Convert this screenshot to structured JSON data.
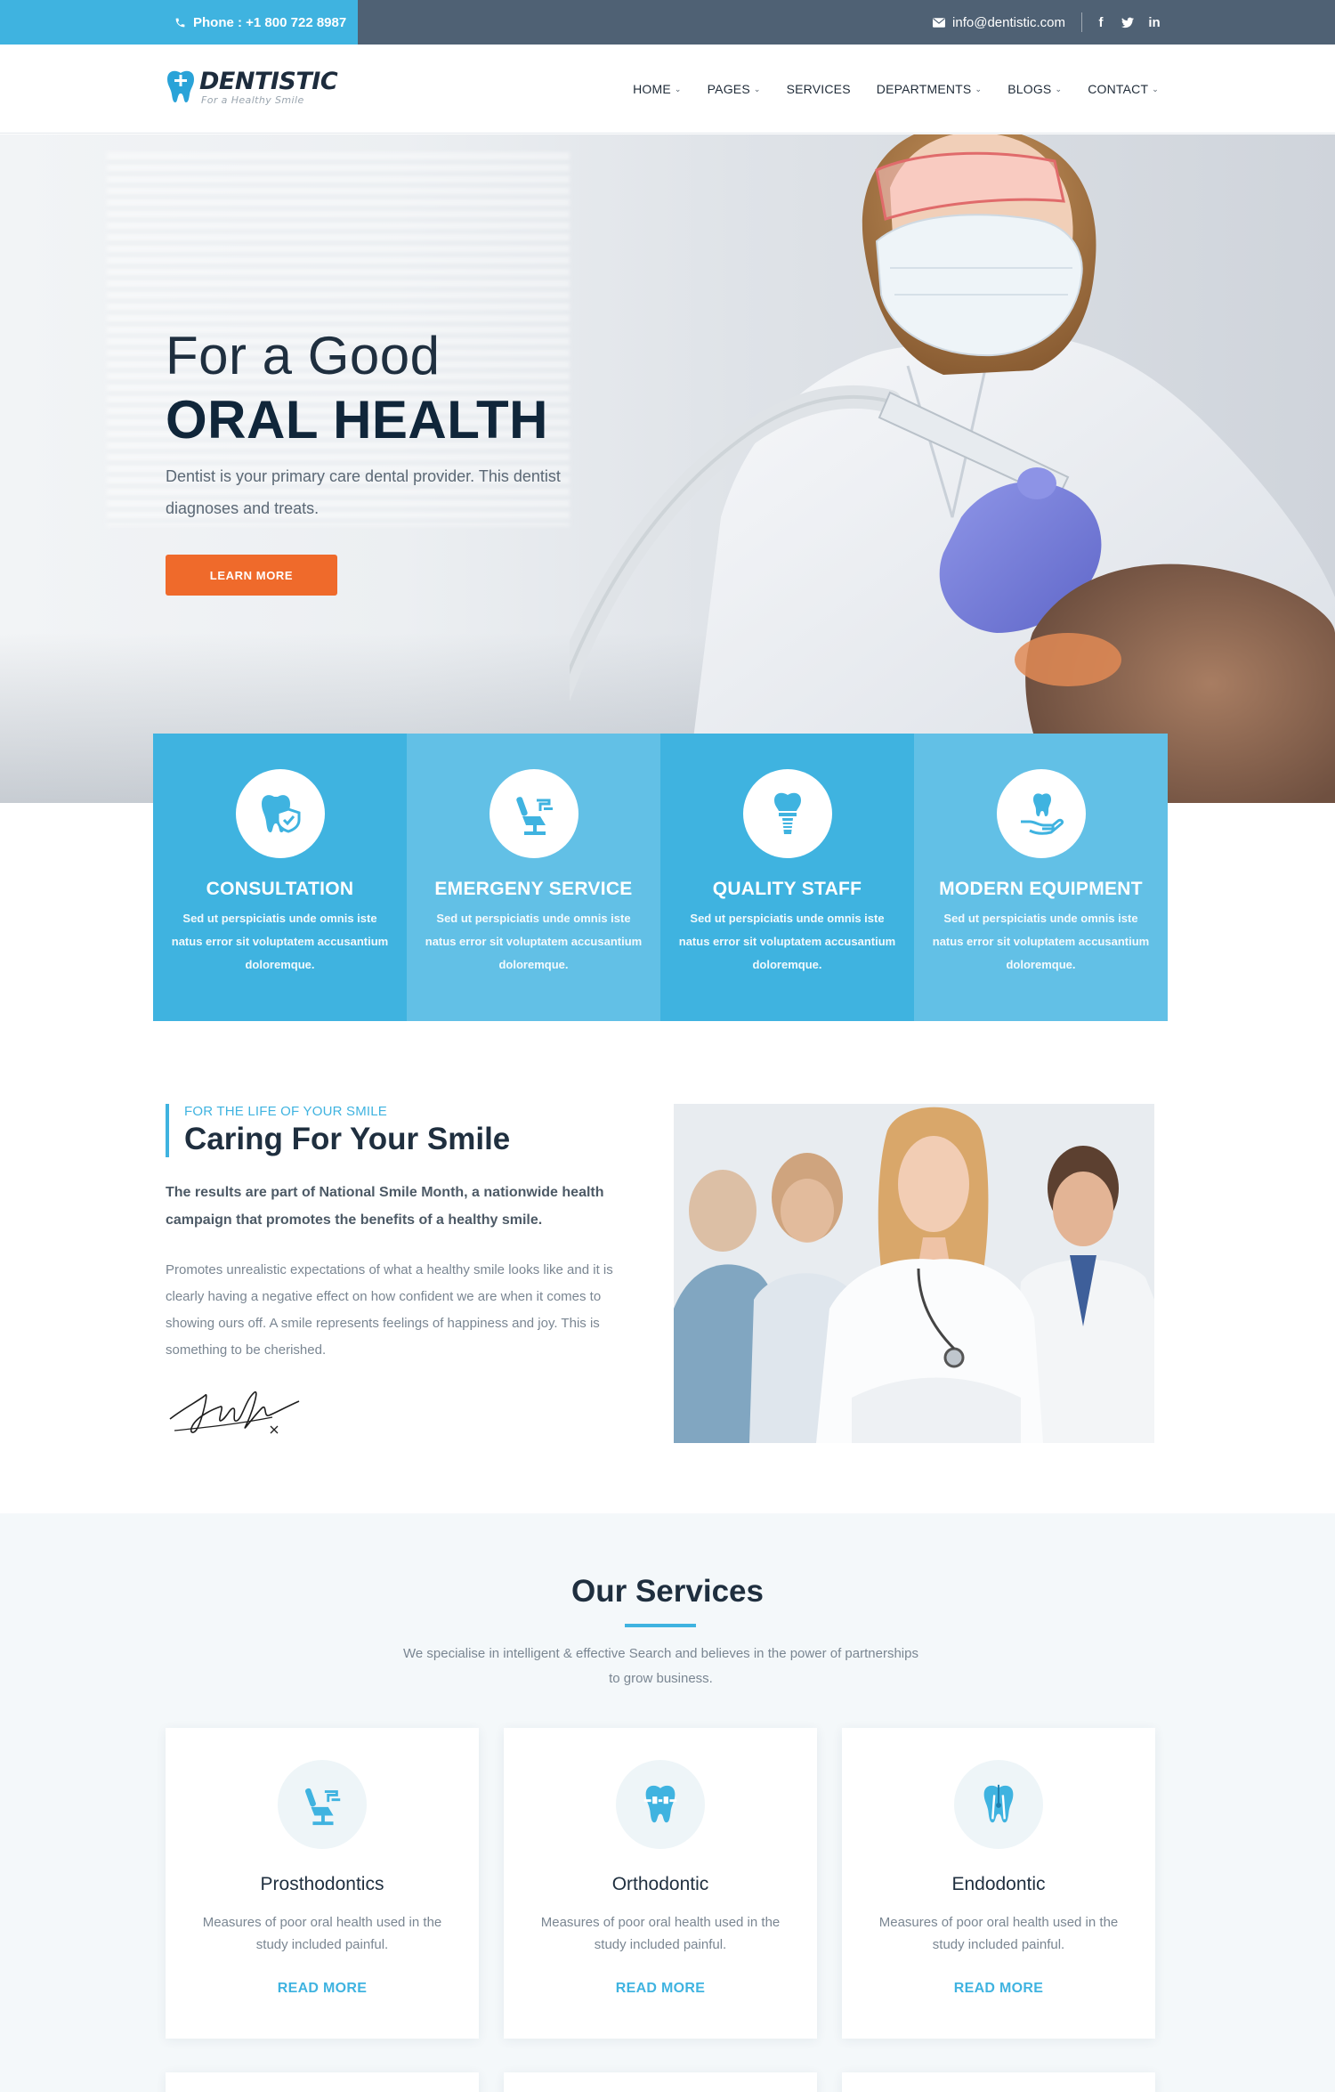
{
  "topbar": {
    "phone": "Phone : +1 800 722 8987",
    "email": "info@dentistic.com",
    "social": [
      {
        "icon": "facebook-icon",
        "glyph": "f"
      },
      {
        "icon": "twitter-icon",
        "glyph": "t"
      },
      {
        "icon": "linkedin-icon",
        "glyph": "in"
      }
    ]
  },
  "brand": {
    "name": "DENTISTIC",
    "tagline": "For a Healthy Smile"
  },
  "nav": {
    "items": [
      {
        "label": "HOME",
        "dropdown": true
      },
      {
        "label": "PAGES",
        "dropdown": true
      },
      {
        "label": "SERVICES",
        "dropdown": false
      },
      {
        "label": "DEPARTMENTS",
        "dropdown": true
      },
      {
        "label": "BLOGS",
        "dropdown": true
      },
      {
        "label": "CONTACT",
        "dropdown": true
      }
    ]
  },
  "hero": {
    "title_line1": "For a Good",
    "title_line2": "ORAL HEALTH",
    "text": "Dentist is your primary care dental provider. This dentist diagnoses and treats.",
    "button": "LEARN MORE"
  },
  "features": [
    {
      "title": "CONSULTATION",
      "desc": "Sed ut perspiciatis unde omnis iste natus error sit voluptatem accusantium doloremque.",
      "icon": "tooth-shield-icon",
      "bg": "#3fb3e0"
    },
    {
      "title": "EMERGENY SERVICE",
      "desc": "Sed ut perspiciatis unde omnis iste natus error sit voluptatem accusantium doloremque.",
      "icon": "dental-chair-icon",
      "bg": "#62c0e6"
    },
    {
      "title": "QUALITY STAFF",
      "desc": "Sed ut perspiciatis unde omnis iste natus error sit voluptatem accusantium doloremque.",
      "icon": "dental-implant-icon",
      "bg": "#3fb3e0"
    },
    {
      "title": "MODERN EQUIPMENT",
      "desc": "Sed ut perspiciatis unde omnis iste natus error sit voluptatem accusantium doloremque.",
      "icon": "tooth-hand-icon",
      "bg": "#62c0e6"
    }
  ],
  "about": {
    "kicker": "FOR THE LIFE OF YOUR SMILE",
    "title": "Caring For Your Smile",
    "lead": "The results are part of National Smile Month, a nationwide health campaign that promotes the benefits of a healthy smile.",
    "body": "Promotes unrealistic expectations of what a healthy smile looks like and it is clearly having a negative effect on how confident we are when it comes to showing ours off. A smile represents feelings of happiness and joy. This is something to be cherished."
  },
  "services": {
    "title": "Our Services",
    "subtitle": "We specialise in intelligent & effective Search and believes in the power of partnerships to grow business.",
    "cards": [
      {
        "name": "Prosthodontics",
        "desc": "Measures of poor oral health used in the study included painful.",
        "link": "READ MORE",
        "icon": "dental-chair-icon"
      },
      {
        "name": "Orthodontic",
        "desc": "Measures of poor oral health used in the study included painful.",
        "link": "READ MORE",
        "icon": "tooth-braces-icon"
      },
      {
        "name": "Endodontic",
        "desc": "Measures of poor oral health used in the study included painful.",
        "link": "READ MORE",
        "icon": "tooth-root-icon"
      }
    ]
  },
  "colors": {
    "accent": "#3fb3e0",
    "accent_light": "#62c0e6",
    "cta": "#ef6a2b",
    "topbar": "#4f6174",
    "heading": "#1f2f3f"
  }
}
